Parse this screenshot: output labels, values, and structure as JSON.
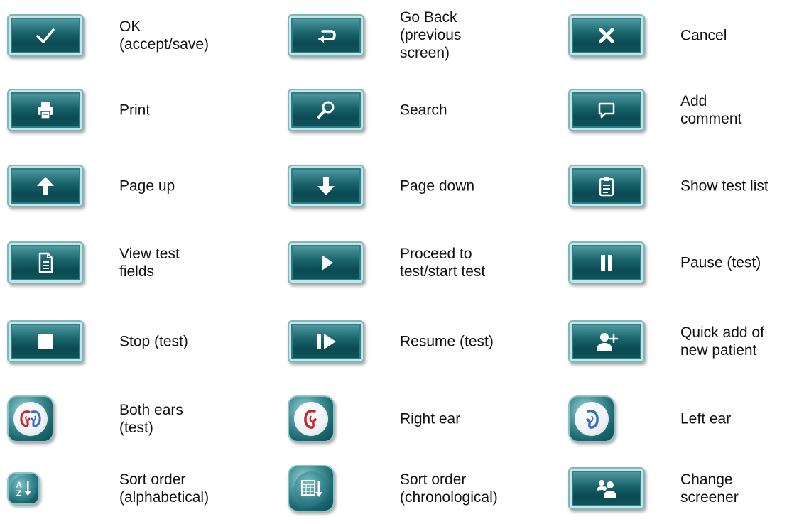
{
  "legend": {
    "items": [
      {
        "icon": "checkmark-icon",
        "label": "OK\n(accept/save)"
      },
      {
        "icon": "return-arrow-icon",
        "label": "Go Back\n(previous\nscreen)"
      },
      {
        "icon": "close-icon",
        "label": "Cancel"
      },
      {
        "icon": "printer-icon",
        "label": "Print"
      },
      {
        "icon": "search-icon",
        "label": "Search"
      },
      {
        "icon": "comment-icon",
        "label": "Add\ncomment"
      },
      {
        "icon": "arrow-up-icon",
        "label": "Page up"
      },
      {
        "icon": "arrow-down-icon",
        "label": "Page down"
      },
      {
        "icon": "clipboard-icon",
        "label": "Show test list"
      },
      {
        "icon": "document-icon",
        "label": "View test\nfields"
      },
      {
        "icon": "play-icon",
        "label": "Proceed to\ntest/start test"
      },
      {
        "icon": "pause-icon",
        "label": "Pause (test)"
      },
      {
        "icon": "stop-icon",
        "label": "Stop (test)"
      },
      {
        "icon": "resume-icon",
        "label": "Resume (test)"
      },
      {
        "icon": "add-user-icon",
        "label": "Quick add of\nnew patient"
      },
      {
        "icon": "both-ears-icon",
        "label": "Both ears\n(test)"
      },
      {
        "icon": "right-ear-icon",
        "label": "Right ear"
      },
      {
        "icon": "left-ear-icon",
        "label": "Left ear"
      },
      {
        "icon": "sort-alphabetical-icon",
        "label": "Sort order\n(alphabetical)"
      },
      {
        "icon": "sort-chronological-icon",
        "label": "Sort order\n(chronological)"
      },
      {
        "icon": "group-users-icon",
        "label": "Change\nscreener"
      }
    ]
  },
  "colors": {
    "button_teal": "#18626a",
    "button_border": "#7fb8bc",
    "right_ear_red": "#c8262c",
    "left_ear_blue": "#3a6fc4",
    "text": "#111111"
  }
}
